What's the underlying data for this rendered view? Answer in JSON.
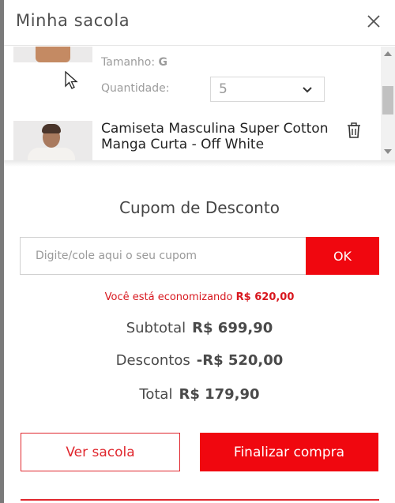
{
  "header": {
    "title": "Minha sacola"
  },
  "cart_items": [
    {
      "size_label": "Tamanho:",
      "size_value": "G",
      "quantity_label": "Quantidade:",
      "quantity_value": "5"
    },
    {
      "name": "Camiseta Masculina Super Cotton Manga Curta - Off White"
    }
  ],
  "coupon": {
    "title": "Cupom de Desconto",
    "placeholder": "Digite/cole aqui o seu cupom",
    "button_label": "OK",
    "savings_prefix": "Você está economizando",
    "savings_amount": "R$ 620,00"
  },
  "summary": {
    "subtotal_label": "Subtotal",
    "subtotal_value": "R$ 699,90",
    "discounts_label": "Descontos",
    "discounts_value": "-R$ 520,00",
    "total_label": "Total",
    "total_value": "R$ 179,90"
  },
  "actions": {
    "view_bag_label": "Ver sacola",
    "checkout_label": "Finalizar compra"
  },
  "icons": {
    "close": "close-icon",
    "trash": "trash-icon",
    "caret": "chevron-down-icon",
    "cursor": "mouse-pointer-icon"
  },
  "colors": {
    "accent": "#f0070f",
    "accent_border": "#e0272e",
    "savings_text": "#d8181f"
  }
}
